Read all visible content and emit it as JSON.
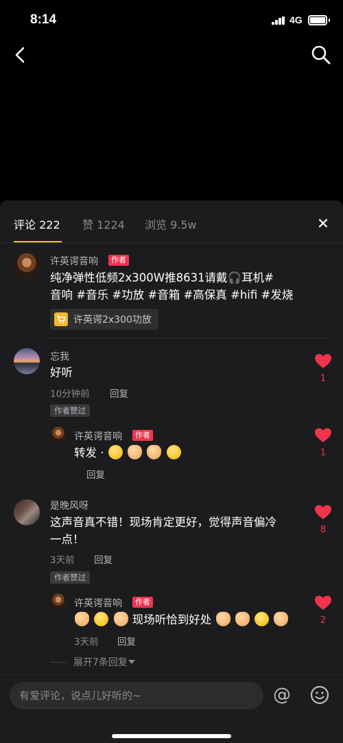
{
  "status": {
    "time": "8:14",
    "network": "4G"
  },
  "tabs": [
    {
      "label": "评论 222"
    },
    {
      "label": "赞 1224"
    },
    {
      "label": "浏览 9.5w"
    }
  ],
  "author_badge": "作者",
  "author_liked": "作者赞过",
  "reply_label": "回复",
  "post": {
    "username": "许英谔音响",
    "text_lines": [
      "纯净弹性低频2x300W推8631请戴🎧耳机#",
      "音响 #音乐 #功放 #音箱 #高保真 #hifi #发烧"
    ],
    "product": "许英谔2x300功放"
  },
  "comments": [
    {
      "username": "忘我",
      "text": "好听",
      "time": "10分钟前",
      "likes": "1",
      "reply": {
        "username": "许英谔音响",
        "text": "转发 ·",
        "likes": "1"
      }
    },
    {
      "username": "是晚风呀",
      "text_lines": [
        "这声音真不错！现场肯定更好，觉得声音偏冷",
        "一点！"
      ],
      "time": "3天前",
      "likes": "8",
      "reply": {
        "username": "许英谔音响",
        "text": "现场听恰到好处",
        "time": "3天前",
        "likes": "2"
      }
    }
  ],
  "expand_more": "展开7条回复",
  "input": {
    "placeholder": "有爱评论，说点儿好听的~"
  },
  "colors": {
    "accent": "#f5c33b",
    "like": "#f0344d",
    "sheet": "#1c1c1e"
  }
}
